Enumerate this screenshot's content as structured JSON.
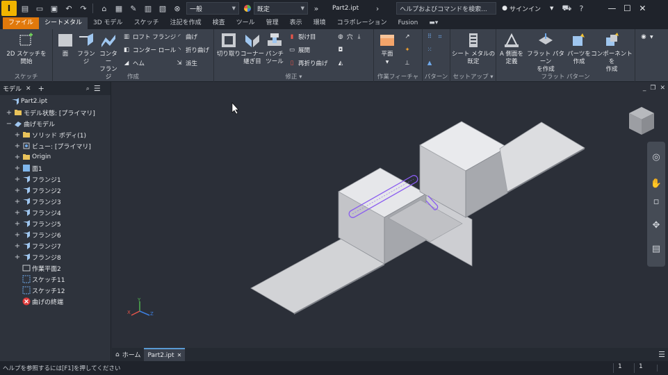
{
  "titlebar": {
    "logo_letter": "I",
    "style_combo": "一般",
    "appearance_combo": "既定",
    "document_title": "Part2.ipt",
    "search_placeholder": "ヘルプおよびコマンドを検索...",
    "signin_label": "サインイン",
    "help_label": "?"
  },
  "tabs": [
    {
      "label": "ファイル"
    },
    {
      "label": "シートメタル"
    },
    {
      "label": "3D モデル"
    },
    {
      "label": "スケッチ"
    },
    {
      "label": "注記を作成"
    },
    {
      "label": "検査"
    },
    {
      "label": "ツール"
    },
    {
      "label": "管理"
    },
    {
      "label": "表示"
    },
    {
      "label": "環境"
    },
    {
      "label": "コラボレーション"
    },
    {
      "label": "Fusion"
    }
  ],
  "ribbon": {
    "sketch": {
      "button_line1": "2D スケッチを",
      "button_line2": "開始",
      "group": "スケッチ"
    },
    "create": {
      "face": "面",
      "flange": "フランジ",
      "contour_line1": "コンター",
      "contour_line2": "フランジ",
      "loft_flange": "ロフト フランジ",
      "contour_roll": "コンター ロール",
      "hem": "ヘム",
      "bend": "曲げ",
      "fold": "折り曲げ",
      "derive": "派生",
      "group": "作成"
    },
    "modify": {
      "cut": "切り取り",
      "corner_seam_line1": "コーナー",
      "corner_seam_line2": "継ぎ目",
      "punch_line1": "パンチ",
      "punch_line2": "ツール",
      "rip": "裂け目",
      "unfold": "展開",
      "refold": "再折り曲げ",
      "hole": "穴",
      "group": "修正"
    },
    "work_features": {
      "plane": "平面",
      "group": "作業フィーチャ"
    },
    "pattern": {
      "group": "パターン"
    },
    "setup": {
      "line1": "シート メタルの",
      "line2": "既定",
      "group": "セットアップ"
    },
    "flat_pattern": {
      "a_side_line1": "A 側面を",
      "a_side_line2": "定義",
      "flat_line1": "フラット パターン",
      "flat_line2": "を作成",
      "part_line1": "パーツを",
      "part_line2": "作成",
      "component_line1": "コンポーネントを",
      "component_line2": "作成",
      "group": "フラット パターン"
    }
  },
  "browser": {
    "tab_label": "モデル",
    "tree": [
      {
        "label": "Part2.ipt",
        "expander": ""
      },
      {
        "label": "モデル状態: [プライマリ]",
        "expander": "+"
      },
      {
        "label": "曲げモデル",
        "expander": "−"
      },
      {
        "label": "ソリッド ボディ(1)",
        "expander": "+"
      },
      {
        "label": "ビュー: [プライマリ]",
        "expander": "+"
      },
      {
        "label": "Origin",
        "expander": "+"
      },
      {
        "label": "面1",
        "expander": "+"
      },
      {
        "label": "フランジ1",
        "expander": "+"
      },
      {
        "label": "フランジ2",
        "expander": "+"
      },
      {
        "label": "フランジ3",
        "expander": "+"
      },
      {
        "label": "フランジ4",
        "expander": "+"
      },
      {
        "label": "フランジ5",
        "expander": "+"
      },
      {
        "label": "フランジ6",
        "expander": "+"
      },
      {
        "label": "フランジ7",
        "expander": "+"
      },
      {
        "label": "フランジ8",
        "expander": "+"
      },
      {
        "label": "作業平面2",
        "expander": ""
      },
      {
        "label": "スケッチ11",
        "expander": ""
      },
      {
        "label": "スケッチ12",
        "expander": ""
      },
      {
        "label": "曲げの終端",
        "expander": ""
      }
    ]
  },
  "doctabs": [
    {
      "label": "ホーム"
    },
    {
      "label": "Part2.ipt"
    }
  ],
  "status": {
    "help_text": "ヘルプを参照するには[F1]を押してください",
    "count1": "1",
    "count2": "1"
  },
  "colors": {
    "accent_file_tab": "#e1790c",
    "selection_outline": "#8a5cf0",
    "error_badge": "#e03a3a"
  }
}
